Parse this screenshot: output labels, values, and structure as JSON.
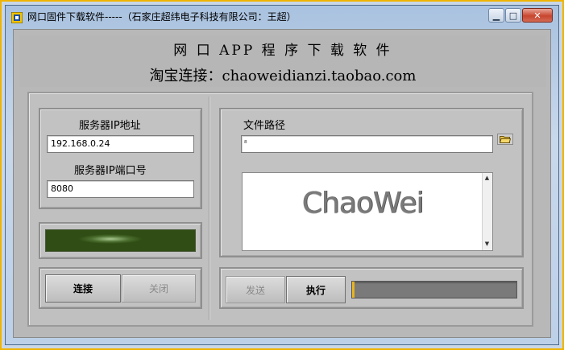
{
  "window": {
    "title": "网口固件下载软件-----（石家庄超纬电子科技有限公司：王超）",
    "controls": {
      "minimize": "▁",
      "maximize": "□",
      "close": "✕"
    }
  },
  "header": {
    "line1": "网 口 APP 程 序 下 载 软 件",
    "line2": "淘宝连接：chaoweidianzi.taobao.com"
  },
  "server": {
    "ip_label": "服务器IP地址",
    "ip_value": "192.168.0.24",
    "port_label": "服务器IP端口号",
    "port_value": "8080"
  },
  "connection": {
    "connect_label": "连接",
    "close_label": "关闭"
  },
  "file": {
    "path_label": "文件路径",
    "path_value": "",
    "path_glyph": "⁸",
    "logo_text": "ChaoWei"
  },
  "actions": {
    "send_label": "发送",
    "execute_label": "执行",
    "progress": 0.01
  },
  "icons": {
    "app": "labview-app-icon",
    "browse": "folder-open-icon",
    "scroll_up": "▲",
    "scroll_down": "▼"
  },
  "colors": {
    "indicator": "#3a5a1e",
    "progress_fill": "#e8b422",
    "progress_track": "#7a7a7a"
  }
}
